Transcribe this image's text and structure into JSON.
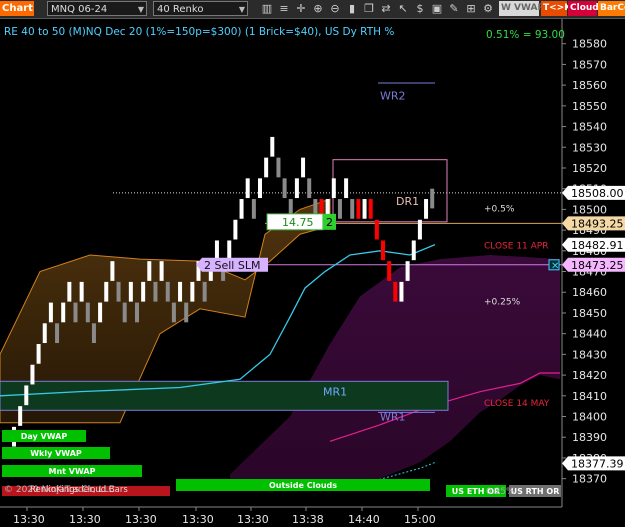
{
  "toolbar": {
    "chart_tab": "Chart",
    "instrument": "MNQ 06-24",
    "bar_type": "40 Renko",
    "icons": [
      "bar-chart-icon",
      "stack-icon",
      "crosshair-icon",
      "zoom-in-icon",
      "zoom-out-icon",
      "bars-icon",
      "copy-icon",
      "arrows-icon",
      "pointer-icon",
      "dollar-icon",
      "lock-icon",
      "pencil-icon",
      "grid-icon",
      "settings-icon"
    ],
    "buttons": [
      {
        "label": "W VWAP",
        "bg": "#d9d9d9",
        "fg": "#666666"
      },
      {
        "label": "T<>K",
        "bg": "#e84c00",
        "fg": "#ffffff"
      },
      {
        "label": "Cloud",
        "bg": "#d4003a",
        "fg": "#ffffff"
      },
      {
        "label": "BarCo",
        "bg": "#ff7a00",
        "fg": "#ffffff"
      }
    ]
  },
  "chart_data": {
    "type": "renko",
    "title": "RE 40 to 50 (M)NQ Dec 20 (1%=150p=$300) (1 Brick=$40), US Dy RTH %",
    "top_right_stat": "0.51% = 93.00",
    "ylim": [
      18365,
      18590
    ],
    "y_ticks": [
      18370,
      18380,
      18390,
      18400,
      18410,
      18420,
      18430,
      18440,
      18450,
      18460,
      18470,
      18480,
      18490,
      18500,
      18510,
      18520,
      18530,
      18540,
      18550,
      18560,
      18570,
      18580
    ],
    "x_ticks": [
      "13:30",
      "13:30",
      "13:30",
      "13:30",
      "13:30",
      "13:38",
      "14:40",
      "15:00"
    ],
    "price_tags": [
      {
        "value": 18508.0,
        "label": "18508.00",
        "bg": "#ffffff",
        "fg": "#000000"
      },
      {
        "value": 18493.25,
        "label": "18493.25",
        "bg": "#f4d9a6",
        "fg": "#000000"
      },
      {
        "value": 18482.91,
        "label": "18482.91",
        "bg": "#ffffff",
        "fg": "#000000"
      },
      {
        "value": 18473.25,
        "label": "18473.25",
        "bg": "#f5b6ff",
        "fg": "#000000"
      },
      {
        "value": 18377.39,
        "label": "18377.39",
        "bg": "#ffffff",
        "fg": "#000000"
      }
    ],
    "level_labels": [
      {
        "text": "WR2",
        "value": 18555,
        "color": "#7b7bd8"
      },
      {
        "text": "DR1",
        "value": 18504,
        "color": "#e8c0b0"
      },
      {
        "text": "MR1",
        "value": 18412,
        "color": "#6fa8ff"
      },
      {
        "text": "WR1",
        "value": 18400,
        "color": "#7b7bd8"
      },
      {
        "text": "+0.5%",
        "value": 18501,
        "color": "#dddddd"
      },
      {
        "text": "CLOSE 11 APR",
        "value": 18483,
        "color": "#e8253a"
      },
      {
        "text": "+0.25%",
        "value": 18456,
        "color": "#dddddd"
      },
      {
        "text": "CLOSE 14 MAY",
        "value": 18407,
        "color": "#e8253a"
      }
    ],
    "order": {
      "sell_label": "2 Sell SLM",
      "price": 18473.25
    },
    "position": {
      "pnl": "14.75",
      "qty": "2"
    },
    "lines": {
      "last_price": 18508.0,
      "vwap_close": 18493.25
    },
    "bottom_labels": [
      {
        "text": "Day VWAP",
        "color": "#00c000"
      },
      {
        "text": "Wkly VWAP",
        "color": "#00c000"
      },
      {
        "text": "Mnt VWAP",
        "color": "#00c000"
      },
      {
        "text": "Outside Clouds",
        "color": "#00c000"
      },
      {
        "text": "US ETH OR",
        "color": "#00c000"
      },
      {
        "text": "US RTH OR",
        "color": "#707070"
      }
    ],
    "footer_text": "© 2020 NinjaTrader, LLC",
    "footer_overlay": "RenkoKings Cloud Bars",
    "footer_pct": "0.25%",
    "bricks": [
      {
        "c": 18395,
        "d": "u"
      },
      {
        "c": 18405,
        "d": "u"
      },
      {
        "c": 18415,
        "d": "u"
      },
      {
        "c": 18425,
        "d": "u"
      },
      {
        "c": 18435,
        "d": "u"
      },
      {
        "c": 18445,
        "d": "u"
      },
      {
        "c": 18455,
        "d": "u"
      },
      {
        "c": 18445,
        "d": "g"
      },
      {
        "c": 18455,
        "d": "u"
      },
      {
        "c": 18465,
        "d": "u"
      },
      {
        "c": 18455,
        "d": "g"
      },
      {
        "c": 18465,
        "d": "u"
      },
      {
        "c": 18455,
        "d": "g"
      },
      {
        "c": 18445,
        "d": "g"
      },
      {
        "c": 18455,
        "d": "u"
      },
      {
        "c": 18465,
        "d": "u"
      },
      {
        "c": 18475,
        "d": "u"
      },
      {
        "c": 18465,
        "d": "g"
      },
      {
        "c": 18455,
        "d": "g"
      },
      {
        "c": 18465,
        "d": "u"
      },
      {
        "c": 18455,
        "d": "g"
      },
      {
        "c": 18465,
        "d": "u"
      },
      {
        "c": 18475,
        "d": "u"
      },
      {
        "c": 18465,
        "d": "g"
      },
      {
        "c": 18475,
        "d": "u"
      },
      {
        "c": 18465,
        "d": "g"
      },
      {
        "c": 18455,
        "d": "g"
      },
      {
        "c": 18465,
        "d": "u"
      },
      {
        "c": 18455,
        "d": "g"
      },
      {
        "c": 18465,
        "d": "u"
      },
      {
        "c": 18475,
        "d": "u"
      },
      {
        "c": 18465,
        "d": "g"
      },
      {
        "c": 18475,
        "d": "u"
      },
      {
        "c": 18485,
        "d": "u"
      },
      {
        "c": 18475,
        "d": "g"
      },
      {
        "c": 18485,
        "d": "u"
      },
      {
        "c": 18495,
        "d": "u"
      },
      {
        "c": 18505,
        "d": "u"
      },
      {
        "c": 18515,
        "d": "u"
      },
      {
        "c": 18505,
        "d": "g"
      },
      {
        "c": 18515,
        "d": "u"
      },
      {
        "c": 18525,
        "d": "u"
      },
      {
        "c": 18535,
        "d": "u"
      },
      {
        "c": 18525,
        "d": "g"
      },
      {
        "c": 18515,
        "d": "g"
      },
      {
        "c": 18505,
        "d": "g"
      },
      {
        "c": 18515,
        "d": "u"
      },
      {
        "c": 18525,
        "d": "u"
      },
      {
        "c": 18515,
        "d": "g"
      },
      {
        "c": 18505,
        "d": "g"
      },
      {
        "c": 18495,
        "d": "r"
      },
      {
        "c": 18505,
        "d": "u"
      },
      {
        "c": 18515,
        "d": "u"
      },
      {
        "c": 18505,
        "d": "g"
      },
      {
        "c": 18515,
        "d": "u"
      },
      {
        "c": 18505,
        "d": "g"
      },
      {
        "c": 18495,
        "d": "r"
      },
      {
        "c": 18505,
        "d": "u"
      },
      {
        "c": 18495,
        "d": "r"
      },
      {
        "c": 18485,
        "d": "r"
      },
      {
        "c": 18475,
        "d": "r"
      },
      {
        "c": 18465,
        "d": "r"
      },
      {
        "c": 18455,
        "d": "r"
      },
      {
        "c": 18465,
        "d": "u"
      },
      {
        "c": 18475,
        "d": "u"
      },
      {
        "c": 18485,
        "d": "u"
      },
      {
        "c": 18495,
        "d": "u"
      },
      {
        "c": 18505,
        "d": "u"
      },
      {
        "c": 18510,
        "d": "g"
      }
    ]
  }
}
